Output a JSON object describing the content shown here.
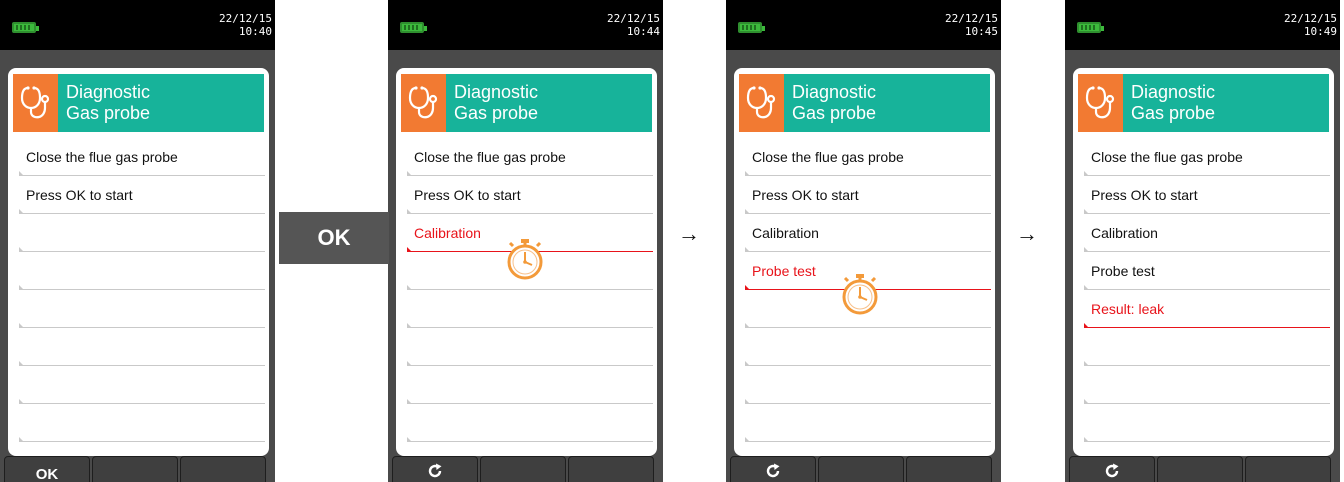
{
  "header": {
    "line1": "Diagnostic",
    "line2": "Gas probe"
  },
  "big_ok_label": "OK",
  "arrows": [
    "→",
    "→"
  ],
  "screens": [
    {
      "date": "22/12/15",
      "time": "10:40",
      "rows": [
        "Close the flue gas probe",
        "Press OK to start",
        "",
        "",
        "",
        "",
        "",
        ""
      ],
      "softkeys": [
        "OK",
        "",
        ""
      ]
    },
    {
      "date": "22/12/15",
      "time": "10:44",
      "rows": [
        "Close the flue gas probe",
        "Press OK to start",
        "Calibration",
        "",
        "",
        "",
        "",
        ""
      ],
      "softkeys": [
        "",
        "",
        ""
      ]
    },
    {
      "date": "22/12/15",
      "time": "10:45",
      "rows": [
        "Close the flue gas probe",
        "Press OK to start",
        "Calibration",
        "Probe test",
        "",
        "",
        "",
        ""
      ],
      "softkeys": [
        "",
        "",
        ""
      ]
    },
    {
      "date": "22/12/15",
      "time": "10:49",
      "rows": [
        "Close the flue gas probe",
        "Press OK to start",
        "Calibration",
        "Probe test",
        "Result: leak",
        "",
        "",
        ""
      ],
      "softkeys": [
        "",
        "",
        ""
      ]
    }
  ],
  "colors": {
    "header": "#17b39a",
    "icon_bg": "#f27a32",
    "active": "#e8131a",
    "timer": "#f39a3a"
  },
  "icons": {
    "header": "stethoscope-icon",
    "refresh": "refresh-icon",
    "timer": "stopwatch-icon"
  }
}
